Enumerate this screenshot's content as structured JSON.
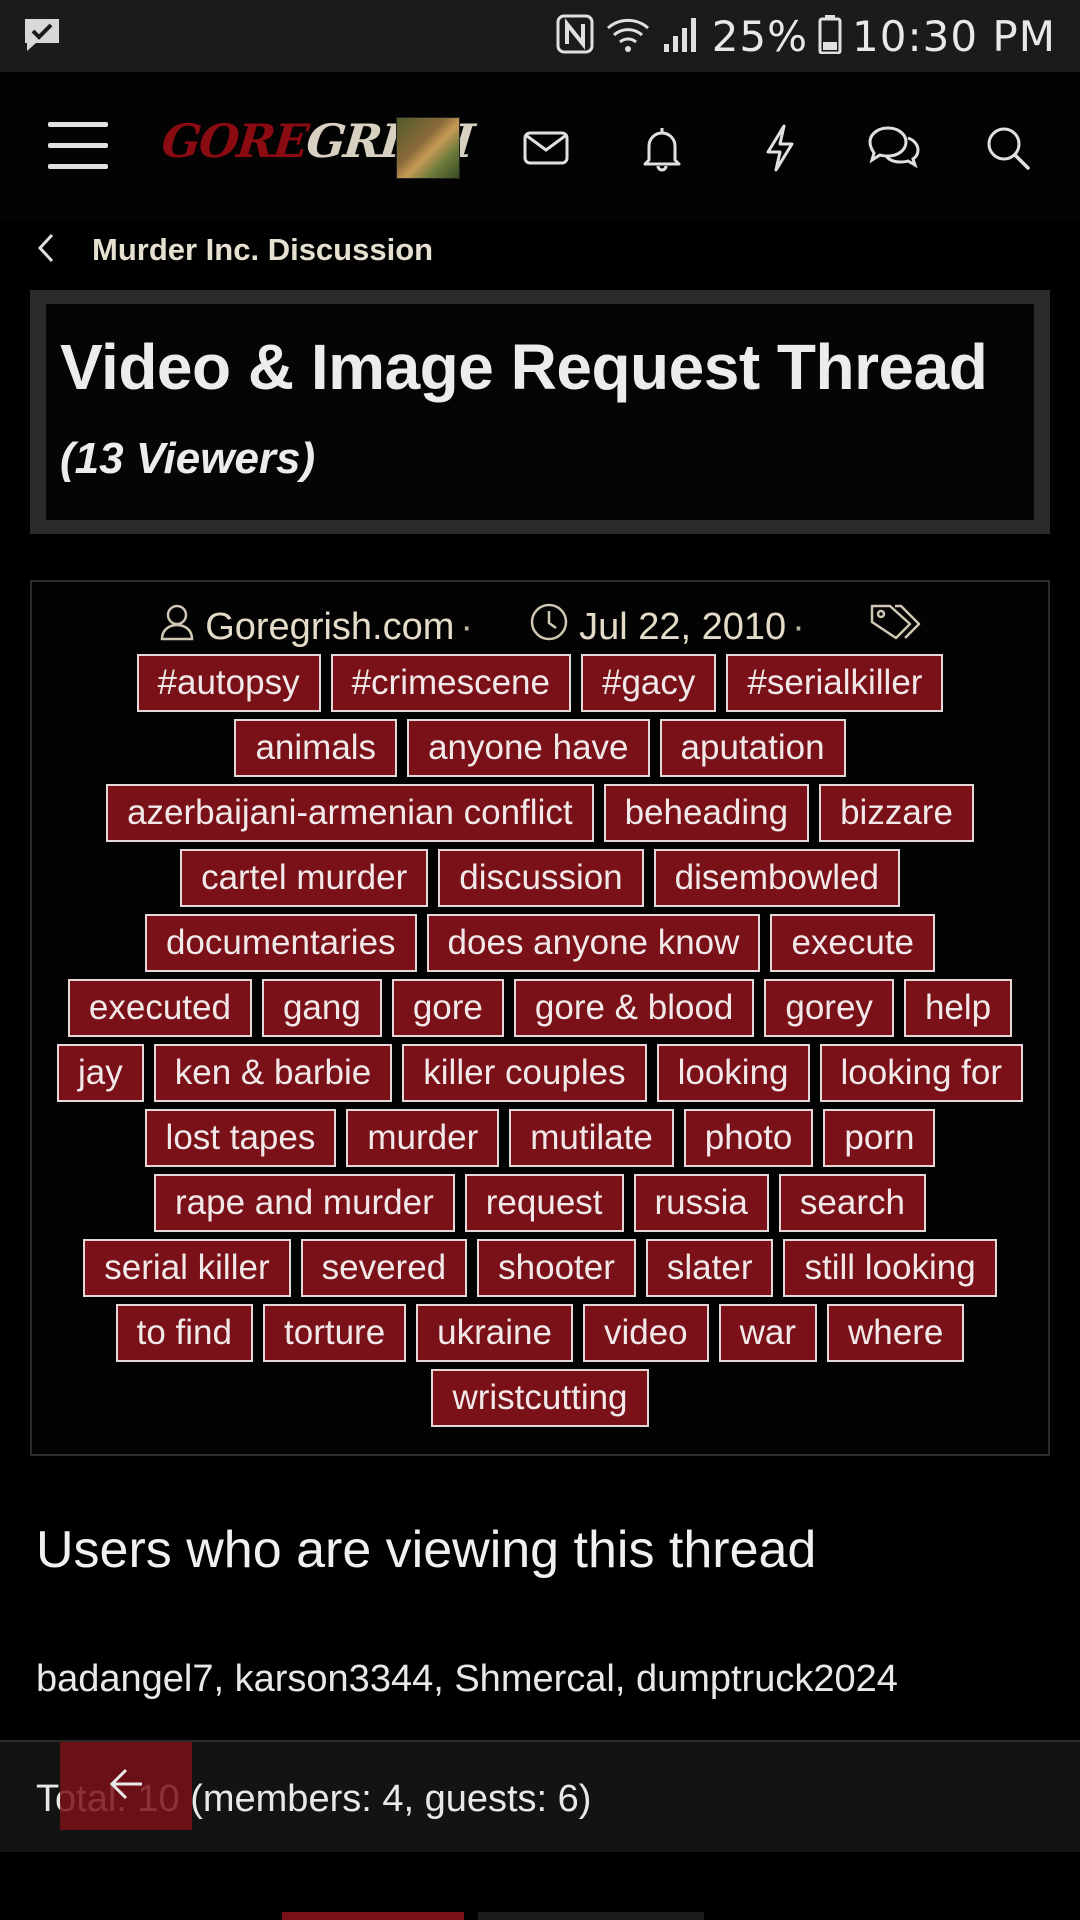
{
  "status_bar": {
    "battery": "25%",
    "time": "10:30 PM"
  },
  "header": {
    "logo_gore": "GORE",
    "logo_grish": "GRISH"
  },
  "breadcrumb": {
    "label": "Murder Inc. Discussion"
  },
  "thread": {
    "title": "Video & Image Request Thread",
    "viewers": "(13 Viewers)",
    "author": "Goregrish.com",
    "date": "Jul 22, 2010",
    "separator": "·"
  },
  "tags": [
    "#autopsy",
    "#crimescene",
    "#gacy",
    "#serialkiller",
    "animals",
    "anyone have",
    "aputation",
    "azerbaijani-armenian conflict",
    "beheading",
    "bizzare",
    "cartel murder",
    "discussion",
    "disembowled",
    "documentaries",
    "does anyone know",
    "execute",
    "executed",
    "gang",
    "gore",
    "gore & blood",
    "gorey",
    "help",
    "jay",
    "ken & barbie",
    "killer couples",
    "looking",
    "looking for",
    "lost tapes",
    "murder",
    "mutilate",
    "photo",
    "porn",
    "rape and murder",
    "request",
    "russia",
    "search",
    "serial killer",
    "severed",
    "shooter",
    "slater",
    "still looking",
    "to find",
    "torture",
    "ukraine",
    "video",
    "war",
    "where",
    "wristcutting"
  ],
  "viewing": {
    "heading": "Users who are viewing this thread",
    "users": "badangel7, karson3344, Shmercal, dumptruck2024",
    "totals": "Total: 10 (members: 4, guests: 6)"
  },
  "colors": {
    "tag_bg": "#7a1018",
    "tag_border": "#e3d7d7",
    "logo_red": "#8b0b12",
    "page_bg": "#000000"
  }
}
